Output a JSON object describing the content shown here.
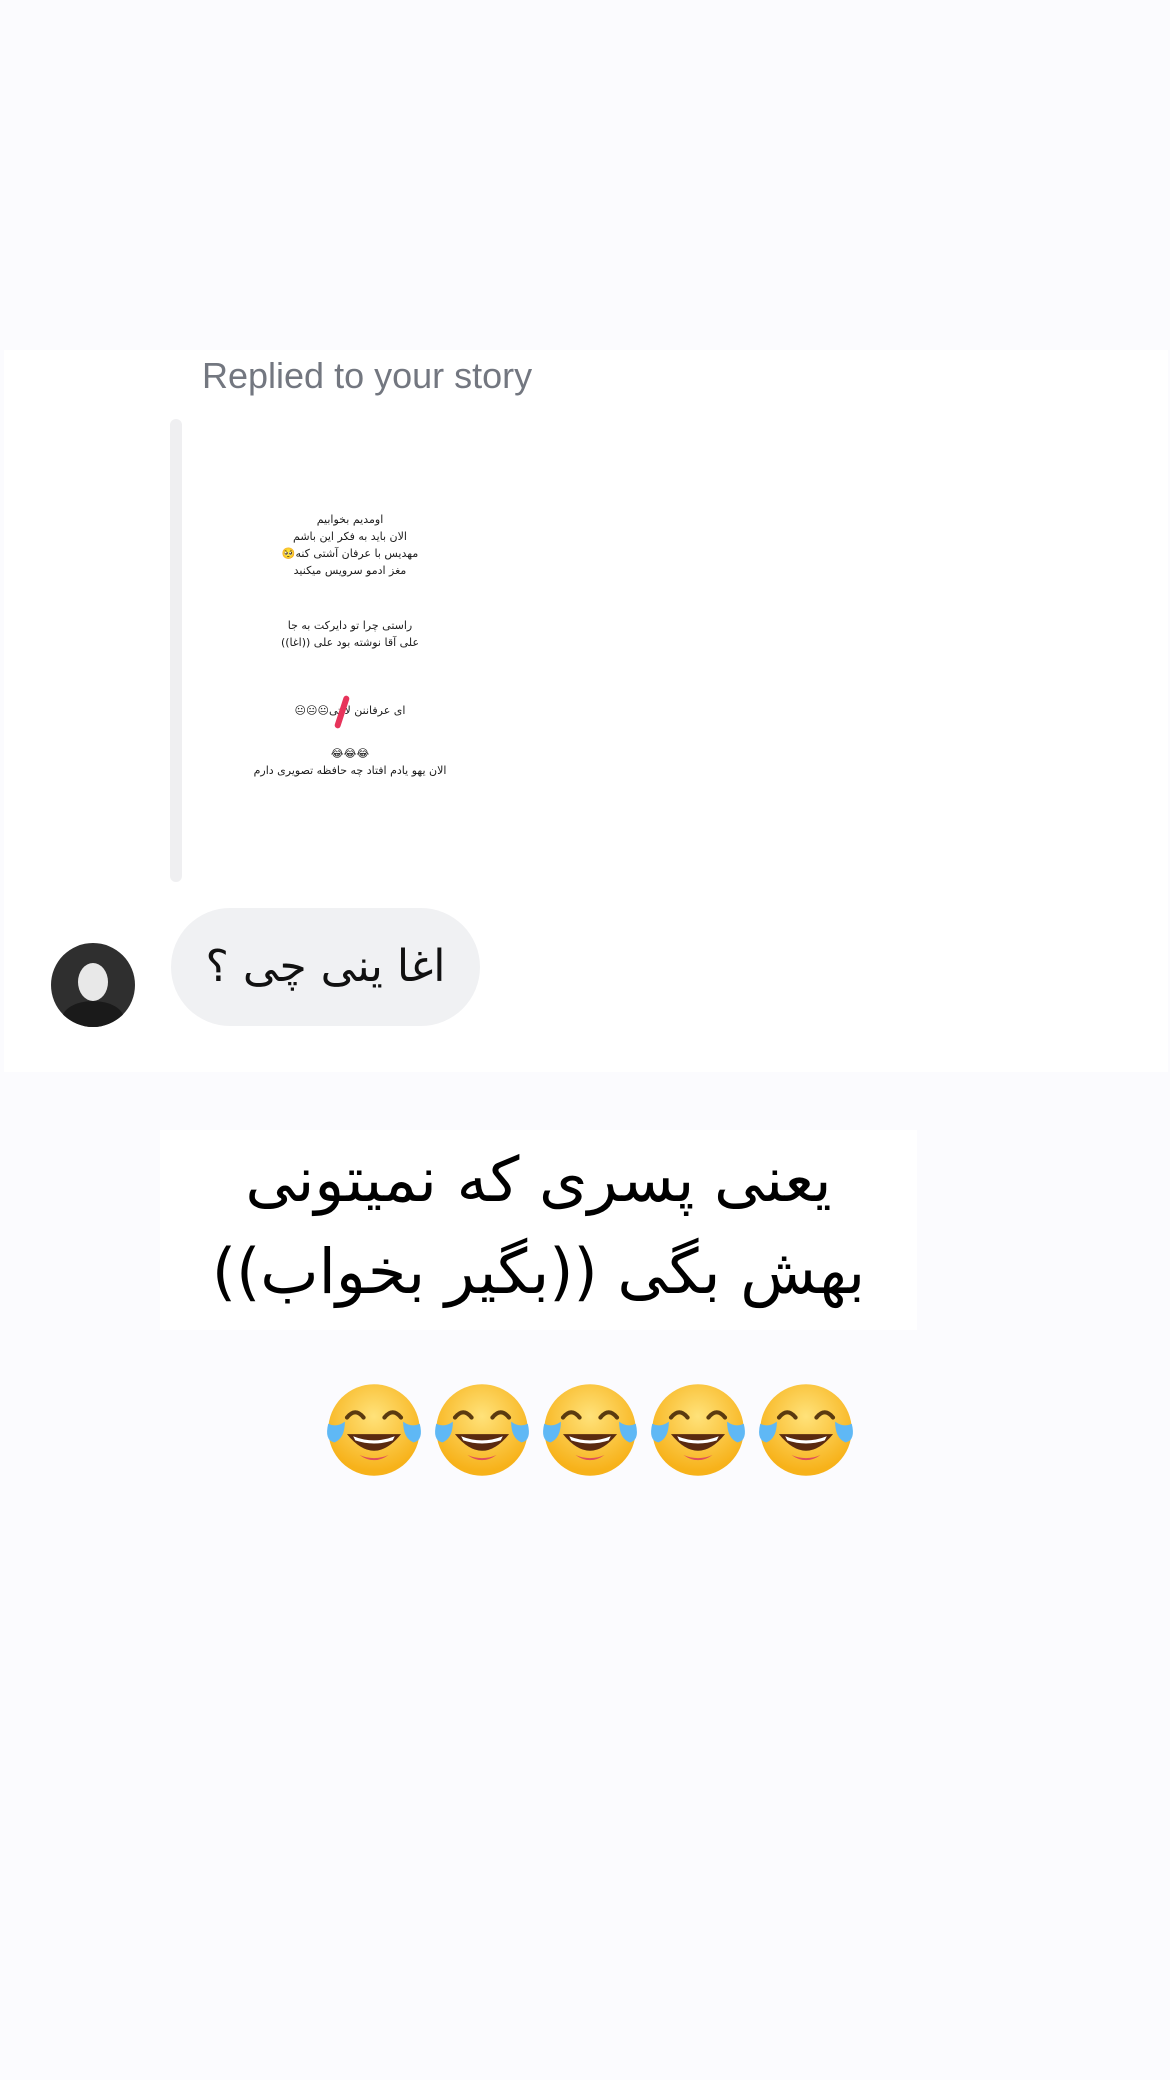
{
  "story_reply": {
    "label": "Replied to your story",
    "story_lines": [
      "اومدیم بخوابیم",
      "الان باید به فکر این باشم",
      "مهدیس با عرفان آشتی کنه🥺",
      "مغز ادمو سرویس میکنید",
      "راستی چرا تو دایرکت به جا",
      "علی آقا نوشته بود علی ((اغا))",
      "ای عرفاننن لانتی😐😐😐",
      "😂😂😂",
      "الان یهو یادم افتاد چه حافظه تصویری دارم"
    ]
  },
  "message": {
    "text": "اغا ینی چی ؟"
  },
  "caption": {
    "line1": "یعنی پسری که نمیتونی",
    "line2": "بهش بگی ((بگیر بخواب))"
  },
  "emoji_row": {
    "icon": "face-with-tears-of-joy",
    "count": 5
  },
  "colors": {
    "page_background": "#fbfbfe",
    "card_background": "#ffffff",
    "reply_label": "#737780",
    "bubble": "#f0f1f3",
    "story_mark": "#e7345b"
  }
}
